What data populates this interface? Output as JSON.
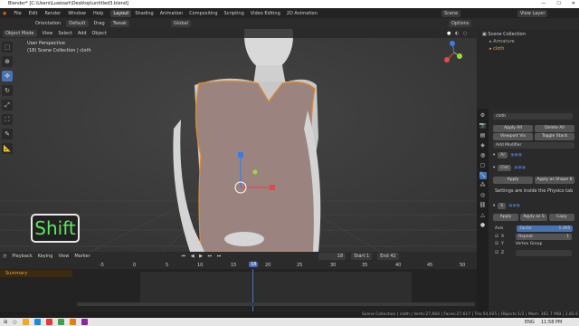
{
  "titlebar": {
    "title": "Blender* [C:\\Users\\Luwizart\\Desktop\\untitled3.blend]",
    "min": "—",
    "max": "☐",
    "close": "✕"
  },
  "menus": [
    "File",
    "Edit",
    "Render",
    "Window",
    "Help"
  ],
  "workspaces": [
    "Layout",
    "Shading",
    "Animation",
    "Compositing",
    "Scripting",
    "Video Editing",
    "2D Animation"
  ],
  "scene": "Scene",
  "view_layer": "View Layer",
  "header": {
    "orientation_label": "Orientation",
    "orientation": "Default",
    "drag_label": "Drag",
    "drag": "Tweak",
    "transform": "Global",
    "options": "Options"
  },
  "viewport_header": {
    "mode": "Object Mode",
    "menus": [
      "View",
      "Select",
      "Add",
      "Object"
    ]
  },
  "viewport": {
    "view_name": "User Perspective",
    "collection": "(18) Scene Collection | cloth"
  },
  "key_overlay": "Shift",
  "outliner": {
    "title": "Scene Collection",
    "items": [
      "Armature",
      "cloth"
    ]
  },
  "properties": {
    "object": "cloth",
    "apply_all": "Apply All",
    "delete_all": "Delete All",
    "viewport_vis": "Viewport Vis",
    "toggle_stack": "Toggle Stack",
    "add_modifier": "Add Modifier",
    "mod1": "Ar",
    "mod2": "Clot",
    "apply": "Apply",
    "apply_shape": "Apply as Shape K",
    "physics_note": "Settings are inside the Physics tab",
    "mod3": "S",
    "apply2": "Apply",
    "apply_as": "Apply as S",
    "copy": "Copy",
    "axis_label": "Axis",
    "factor_label": "Factor",
    "factor": "1.365",
    "repeat_label": "Repeat",
    "repeat": "1",
    "vertex_group": "Vertex Group",
    "x": "X",
    "y": "Y",
    "z": "Z"
  },
  "timeline": {
    "menus": [
      "Playback",
      "Keying",
      "View",
      "Marker"
    ],
    "current_frame": "18",
    "start_label": "Start",
    "start": "1",
    "end_label": "End",
    "end": "42",
    "summary": "Summary",
    "ticks": [
      "-5",
      "0",
      "5",
      "10",
      "15",
      "18",
      "20",
      "25",
      "30",
      "35",
      "40",
      "45",
      "50",
      "55"
    ]
  },
  "status": "Scene Collection | cloth | Verts:27,664 | Faces:27,617 | Tris:54,925 | Objects:1/2 | Mem: 361.7 MiB | 2.82.6",
  "taskbar": {
    "lang": "ENG",
    "time": "11:58 PM"
  }
}
